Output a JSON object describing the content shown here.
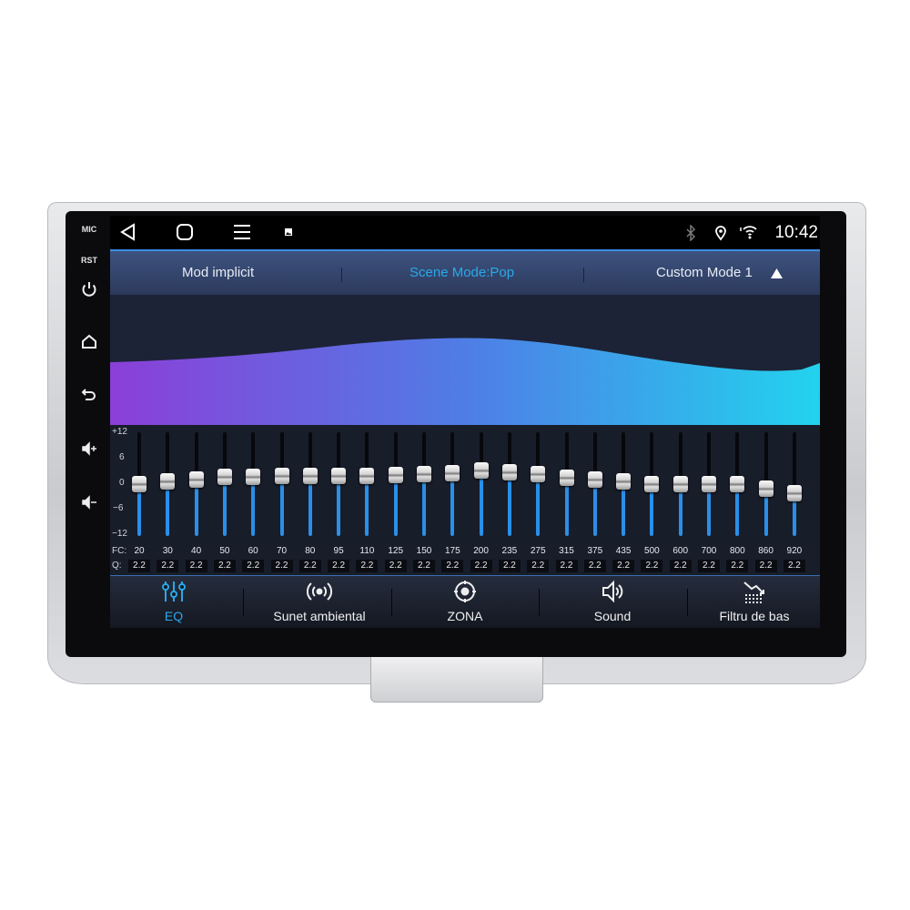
{
  "side_buttons": {
    "mic": "MIC",
    "rst": "RST",
    "icons": [
      "power-icon",
      "home-icon",
      "back-icon",
      "volume-up-icon",
      "volume-down-icon"
    ]
  },
  "status_bar": {
    "time": "10:42",
    "icons": [
      "back-nav-icon",
      "home-nav-icon",
      "menu-nav-icon",
      "gallery-notification-icon",
      "bluetooth-icon",
      "location-icon",
      "wifi-icon"
    ]
  },
  "mode_bar": {
    "default_mode": "Mod implicit",
    "scene_mode": "Scene Mode:Pop",
    "custom_mode": "Custom Mode 1"
  },
  "eq": {
    "scale": [
      "+12",
      "6",
      "0",
      "−6",
      "−12"
    ],
    "range": [
      -12,
      12
    ],
    "fc_label": "FC:",
    "q_label": "Q:",
    "bands": [
      {
        "fc": "20",
        "q": "2.2",
        "gain": 0
      },
      {
        "fc": "30",
        "q": "2.2",
        "gain": 0.6
      },
      {
        "fc": "40",
        "q": "2.2",
        "gain": 1.1
      },
      {
        "fc": "50",
        "q": "2.2",
        "gain": 1.6
      },
      {
        "fc": "60",
        "q": "2.2",
        "gain": 1.6
      },
      {
        "fc": "70",
        "q": "2.2",
        "gain": 1.8
      },
      {
        "fc": "80",
        "q": "2.2",
        "gain": 1.9
      },
      {
        "fc": "95",
        "q": "2.2",
        "gain": 1.9
      },
      {
        "fc": "110",
        "q": "2.2",
        "gain": 2.0
      },
      {
        "fc": "125",
        "q": "2.2",
        "gain": 2.1
      },
      {
        "fc": "150",
        "q": "2.2",
        "gain": 2.4
      },
      {
        "fc": "175",
        "q": "2.2",
        "gain": 2.6
      },
      {
        "fc": "200",
        "q": "2.2",
        "gain": 3.2
      },
      {
        "fc": "235",
        "q": "2.2",
        "gain": 2.8
      },
      {
        "fc": "275",
        "q": "2.2",
        "gain": 2.4
      },
      {
        "fc": "315",
        "q": "2.2",
        "gain": 1.5
      },
      {
        "fc": "375",
        "q": "2.2",
        "gain": 1.1
      },
      {
        "fc": "435",
        "q": "2.2",
        "gain": 0.6
      },
      {
        "fc": "500",
        "q": "2.2",
        "gain": 0.1
      },
      {
        "fc": "600",
        "q": "2.2",
        "gain": 0
      },
      {
        "fc": "700",
        "q": "2.2",
        "gain": 0
      },
      {
        "fc": "800",
        "q": "2.2",
        "gain": -0.1
      },
      {
        "fc": "860",
        "q": "2.2",
        "gain": -1.1
      },
      {
        "fc": "920",
        "q": "2.2",
        "gain": -2.1
      }
    ],
    "colors": {
      "fill": "#2a8fe8",
      "curve_start": "#8b3fd8",
      "curve_mid": "#4f7de6",
      "curve_end": "#22d3ee"
    }
  },
  "tabs": [
    {
      "label": "EQ",
      "icon": "equalizer-icon",
      "active": true
    },
    {
      "label": "Sunet ambiental",
      "icon": "surround-icon"
    },
    {
      "label": "ZONA",
      "icon": "zone-target-icon"
    },
    {
      "label": "Sound",
      "icon": "speaker-icon"
    },
    {
      "label": "Filtru de bas",
      "icon": "bass-filter-icon"
    }
  ],
  "accent": "#2aa8e8"
}
